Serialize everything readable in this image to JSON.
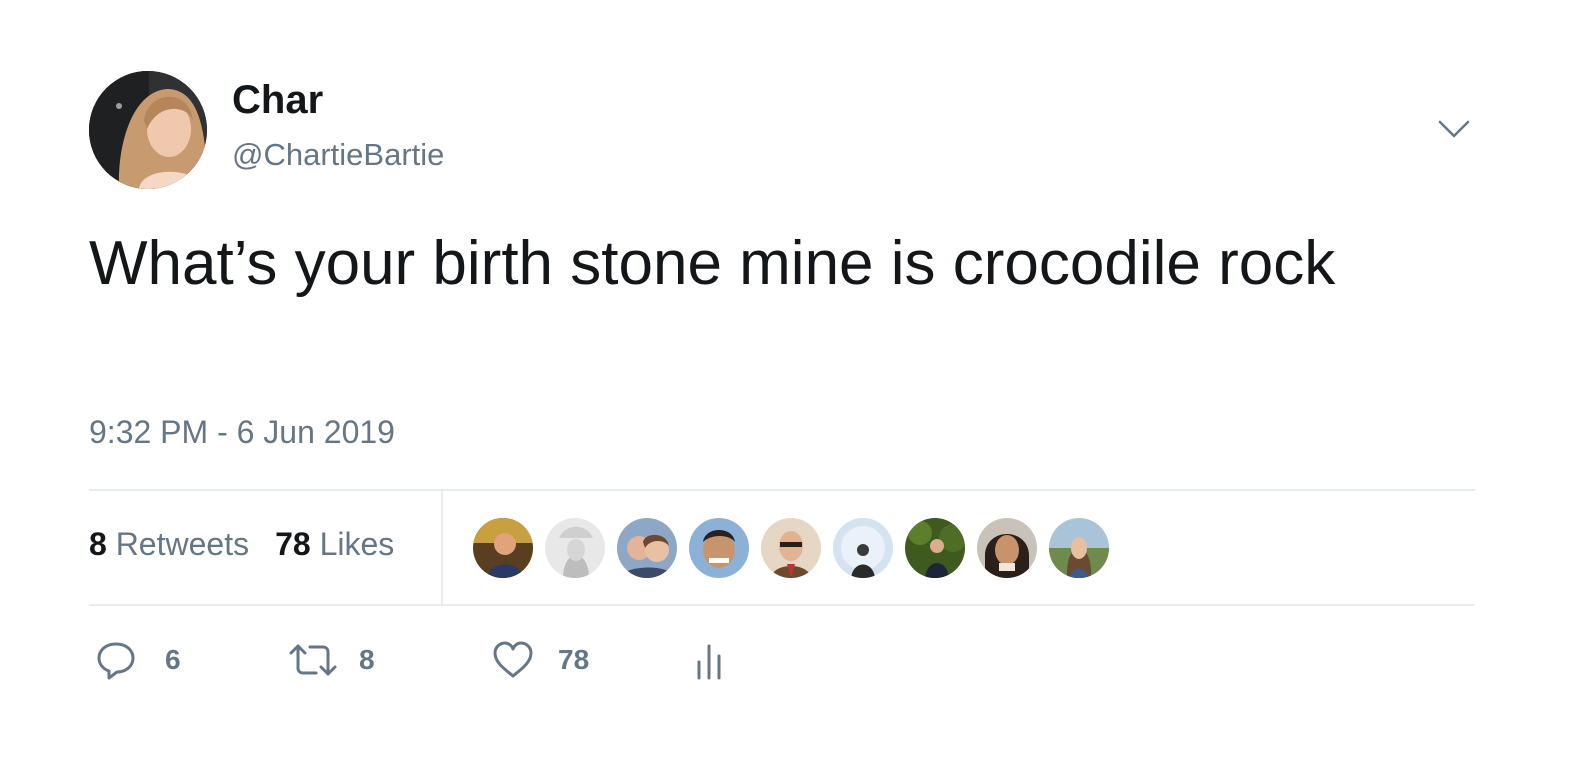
{
  "tweet": {
    "author": {
      "display_name": "Char",
      "handle": "@ChartieBartie"
    },
    "text": "What’s your birth stone mine is crocodile rock",
    "timestamp": "9:32 PM - 6 Jun 2019",
    "stats": {
      "retweets_count": "8",
      "retweets_label": "Retweets",
      "likes_count": "78",
      "likes_label": "Likes"
    },
    "liker_avatar_count": 9,
    "actions": {
      "reply_count": "6",
      "retweet_count": "8",
      "like_count": "78"
    }
  },
  "colors": {
    "text_primary": "#14171a",
    "text_secondary": "#657786",
    "divider": "#e6ecf0",
    "icon": "#657786"
  },
  "icons": {
    "caret": "chevron-down-icon",
    "reply": "reply-icon",
    "retweet": "retweet-icon",
    "like": "heart-icon",
    "analytics": "analytics-icon"
  }
}
